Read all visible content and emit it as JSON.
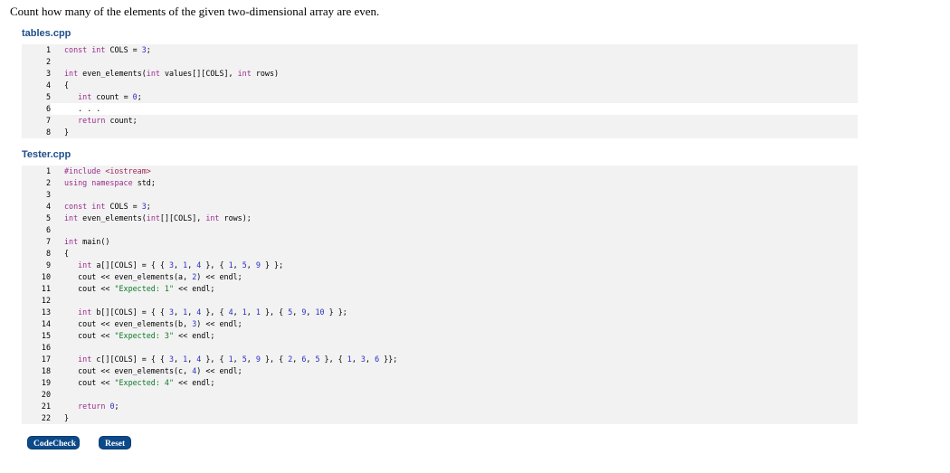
{
  "prompt": "Count how many of the elements of the given two-dimensional array are even.",
  "files": [
    {
      "name": "tables.cpp",
      "lines": [
        {
          "n": "1",
          "code": "const int COLS = 3;"
        },
        {
          "n": "2",
          "code": ""
        },
        {
          "n": "3",
          "code": "int even_elements(int values[][COLS], int rows)"
        },
        {
          "n": "4",
          "code": "{"
        },
        {
          "n": "5",
          "code": "   int count = 0;"
        },
        {
          "n": "6",
          "code": "   . . .",
          "editable": true
        },
        {
          "n": "7",
          "code": "   return count;"
        },
        {
          "n": "8",
          "code": "}"
        }
      ]
    },
    {
      "name": "Tester.cpp",
      "lines": [
        {
          "n": "1",
          "code": "#include <iostream>"
        },
        {
          "n": "2",
          "code": "using namespace std;"
        },
        {
          "n": "3",
          "code": ""
        },
        {
          "n": "4",
          "code": "const int COLS = 3;"
        },
        {
          "n": "5",
          "code": "int even_elements(int[][COLS], int rows);"
        },
        {
          "n": "6",
          "code": ""
        },
        {
          "n": "7",
          "code": "int main()"
        },
        {
          "n": "8",
          "code": "{"
        },
        {
          "n": "9",
          "code": "   int a[][COLS] = { { 3, 1, 4 }, { 1, 5, 9 } };"
        },
        {
          "n": "10",
          "code": "   cout << even_elements(a, 2) << endl;"
        },
        {
          "n": "11",
          "code": "   cout << \"Expected: 1\" << endl;"
        },
        {
          "n": "12",
          "code": ""
        },
        {
          "n": "13",
          "code": "   int b[][COLS] = { { 3, 1, 4 }, { 4, 1, 1 }, { 5, 9, 10 } };"
        },
        {
          "n": "14",
          "code": "   cout << even_elements(b, 3) << endl;"
        },
        {
          "n": "15",
          "code": "   cout << \"Expected: 3\" << endl;"
        },
        {
          "n": "16",
          "code": ""
        },
        {
          "n": "17",
          "code": "   int c[][COLS] = { { 3, 1, 4 }, { 1, 5, 9 }, { 2, 6, 5 }, { 1, 3, 6 }};"
        },
        {
          "n": "18",
          "code": "   cout << even_elements(c, 4) << endl;"
        },
        {
          "n": "19",
          "code": "   cout << \"Expected: 4\" << endl;"
        },
        {
          "n": "20",
          "code": ""
        },
        {
          "n": "21",
          "code": "   return 0;"
        },
        {
          "n": "22",
          "code": "}"
        }
      ]
    }
  ],
  "buttons": {
    "codecheck": "CodeCheck",
    "reset": "Reset"
  },
  "colors": {
    "keyword": "#9b2b8e",
    "number": "#2c2cc8",
    "string": "#0b7a28",
    "button": "#0d4a8a"
  }
}
